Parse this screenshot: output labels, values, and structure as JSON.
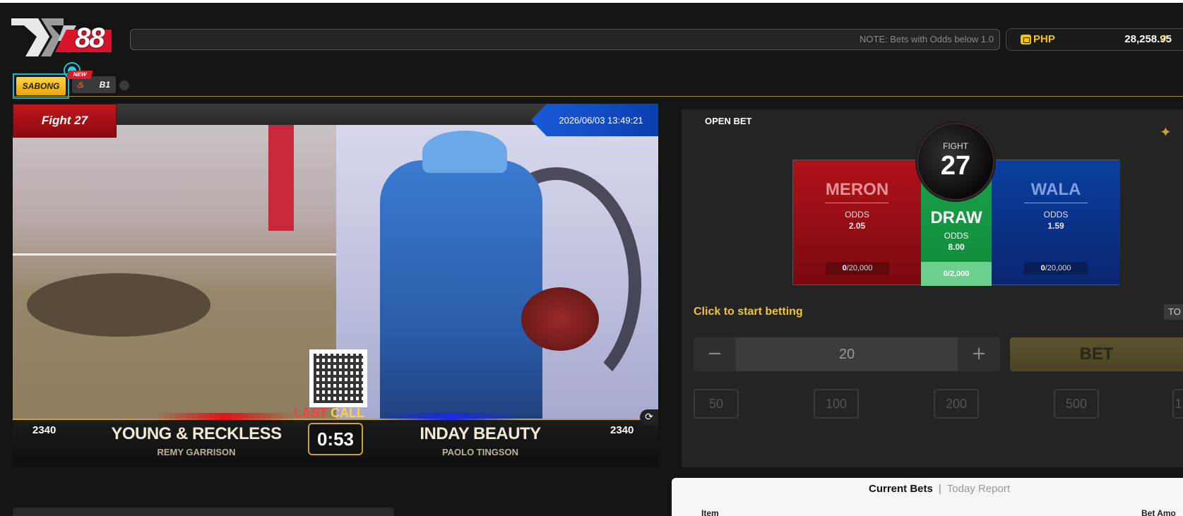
{
  "header": {
    "logo_text": "88",
    "notice": "NOTE: Bets with Odds below 1.0",
    "wallet": {
      "currency": "PHP",
      "balance": "28,258.95"
    }
  },
  "tabs": [
    {
      "label": "SABONG"
    },
    {
      "label": "B1",
      "badge": "NEW"
    }
  ],
  "video": {
    "fight_label": "Fight 27",
    "datetime": "2026/06/03 13:49:21",
    "last_call_a": "LAST",
    "last_call_b": "CALL",
    "left": {
      "number": "2340",
      "name": "YOUNG & RECKLESS",
      "handler": "REMY GARRISON"
    },
    "right": {
      "number": "2340",
      "name": "INDAY BEAUTY",
      "handler": "PAOLO TINGSON"
    },
    "timer": "0:53"
  },
  "bet": {
    "status": "OPEN BET",
    "fight_label": "FIGHT",
    "fight_number": "27",
    "meron": {
      "title": "MERON",
      "odds_label": "ODDS",
      "odds": "2.05",
      "used": "0",
      "limit": "/20,000"
    },
    "draw": {
      "title": "DRAW",
      "odds_label": "ODDS",
      "odds": "8.00",
      "used": "0",
      "limit": "/2,000"
    },
    "wala": {
      "title": "WALA",
      "odds_label": "ODDS",
      "odds": "1.59",
      "used": "0",
      "limit": "/20,000"
    },
    "start_text": "Click to start betting",
    "to_label": "TO",
    "amount": "20",
    "minus": "−",
    "plus": "+",
    "bet_label": "BET",
    "chips": [
      "50",
      "100",
      "200",
      "500",
      "1"
    ]
  },
  "report": {
    "tab_current": "Current Bets",
    "separator": "|",
    "tab_today": "Today Report",
    "col_item": "Item",
    "col_amount": "Bet Amo"
  },
  "colors": {
    "meron": "#b0121a",
    "draw": "#19a24a",
    "wala": "#0a3fa0",
    "accent": "#f0c531"
  }
}
